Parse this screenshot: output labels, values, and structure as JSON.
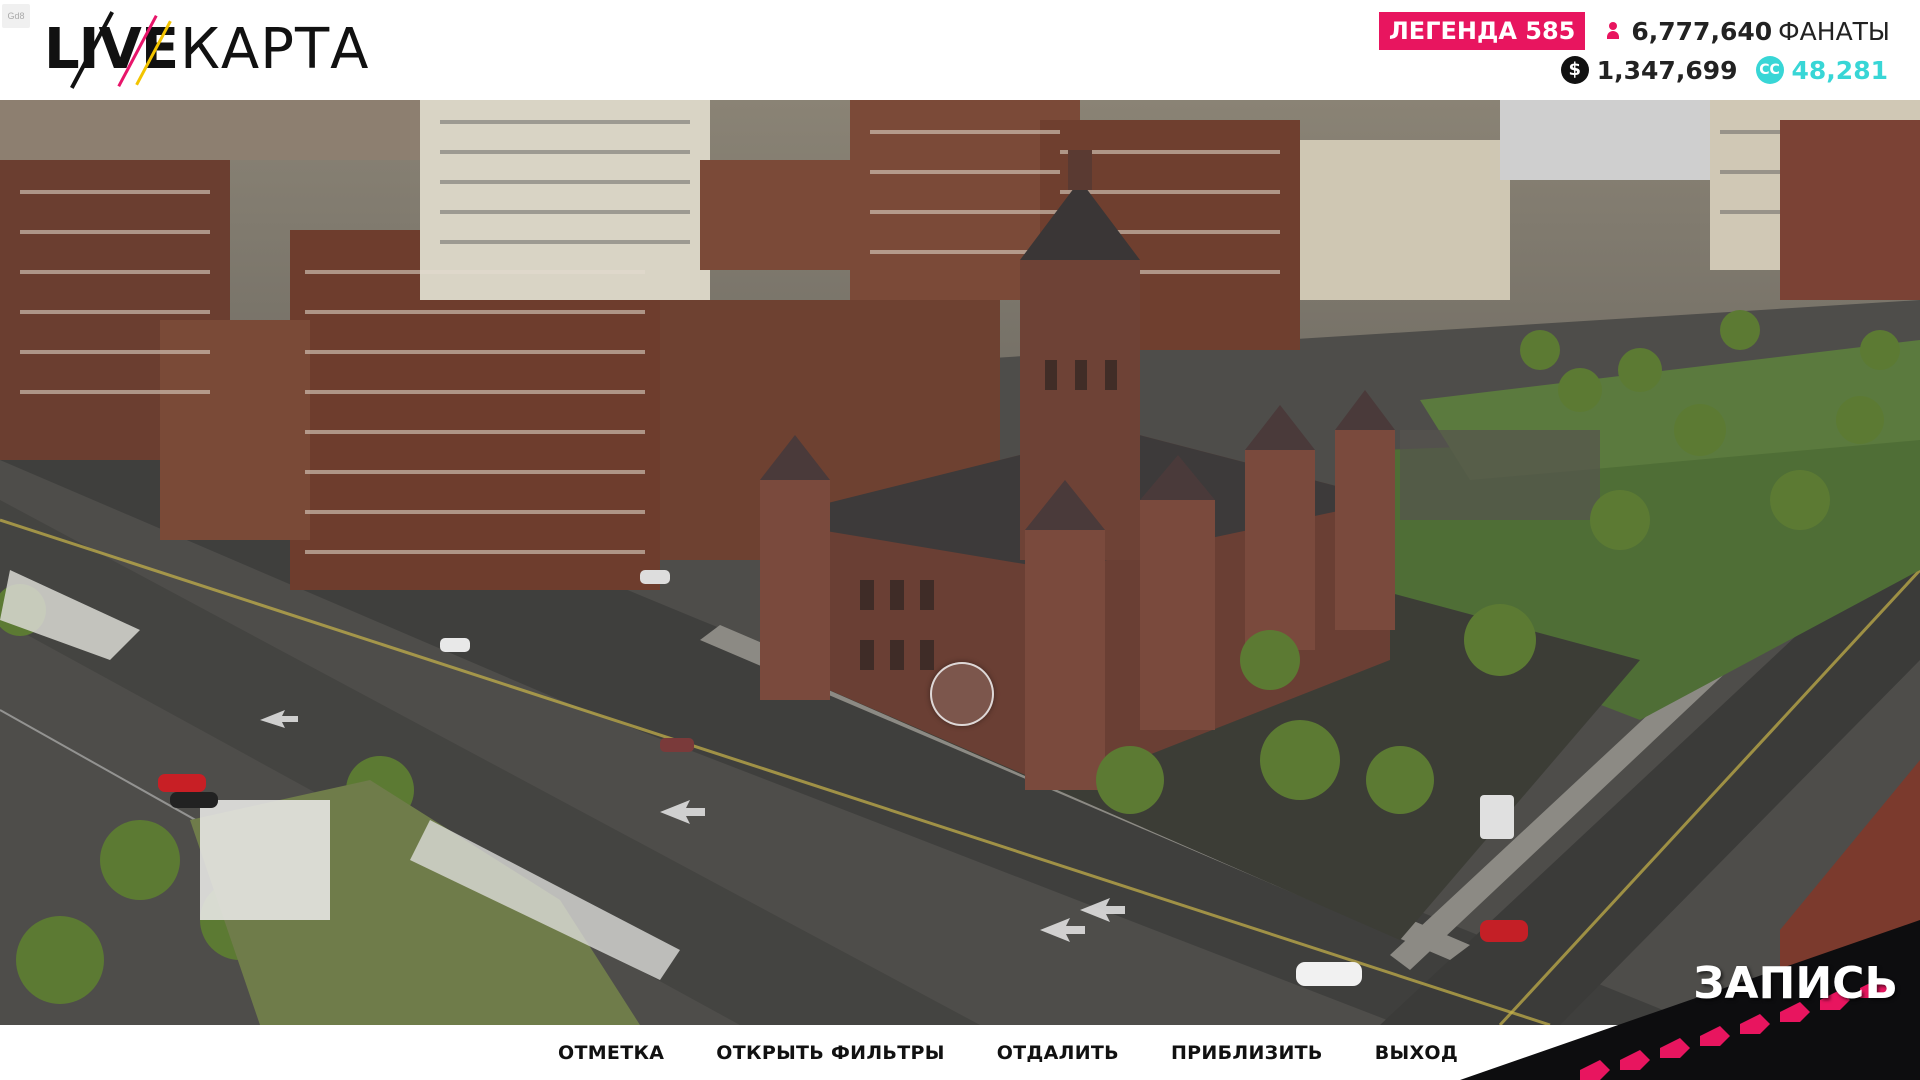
{
  "corner_tag": "Gd8",
  "logo": {
    "part1": "LIVE",
    "part2": "КАРТА"
  },
  "stats": {
    "legend_label": "ЛЕГЕНДА 585",
    "fans_value": "6,777,640",
    "fans_label": "ФАНАТЫ",
    "money_value": "1,347,699",
    "cc_value": "48,281"
  },
  "actions": [
    "ОТМЕТКА",
    "ОТКРЫТЬ ФИЛЬТРЫ",
    "ОТДАЛИТЬ",
    "ПРИБЛИЗИТЬ",
    "ВЫХОД"
  ],
  "record_label": "ЗАПИСЬ",
  "icons": {
    "fans": "people-icon",
    "money": "money-coin-icon",
    "cc": "cc-coin-icon",
    "cursor": "map-cursor-icon"
  },
  "colors": {
    "accent_pink": "#e8155f",
    "cc_cyan": "#38d6d6",
    "text_dark": "#111111"
  }
}
